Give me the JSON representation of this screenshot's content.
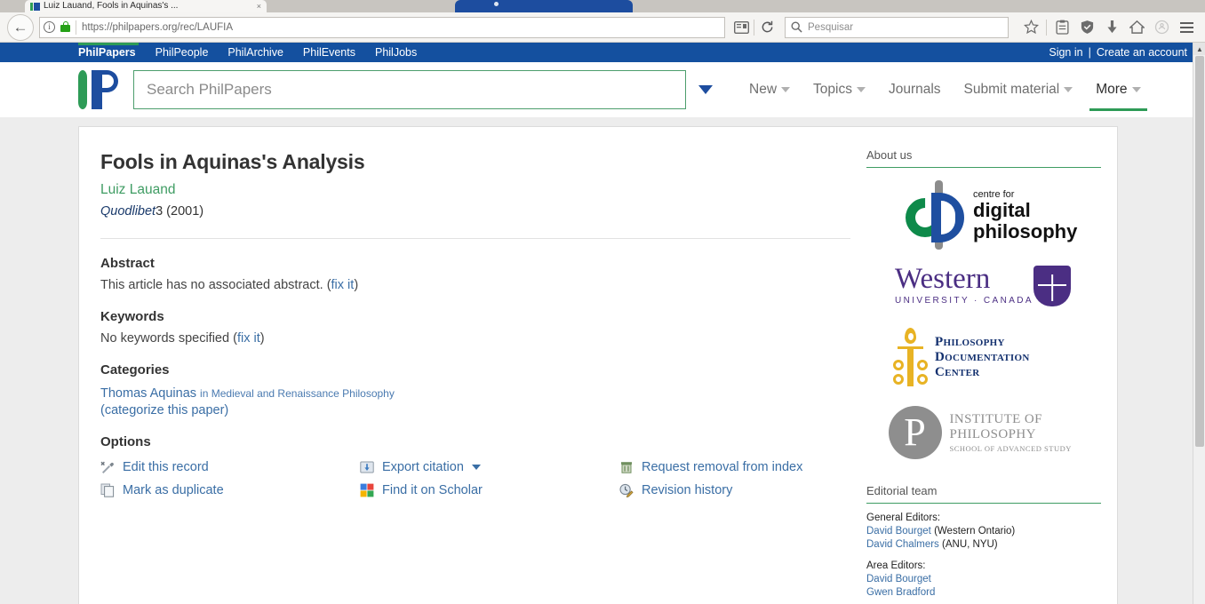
{
  "browser": {
    "tab": {
      "title": "Luiz Lauand, Fools in Aquinas's ...",
      "close_label": "×",
      "favicon": "philpapers-favicon"
    },
    "back_label": "←",
    "url": {
      "scheme": "https://",
      "domain": "philpapers.org",
      "path": "/rec/LAUFIA",
      "full": "https://philpapers.org/rec/LAUFIA"
    },
    "search": {
      "placeholder": "Pesquisar",
      "value": ""
    },
    "icons": [
      "reader-mode-icon",
      "reload-icon",
      "bookmark-star-icon",
      "reading-list-icon",
      "shield-icon",
      "downloads-icon",
      "home-icon",
      "sync-icon",
      "menu-icon"
    ]
  },
  "topnav": {
    "items": [
      {
        "label": "PhilPapers",
        "active": true
      },
      {
        "label": "PhilPeople",
        "active": false
      },
      {
        "label": "PhilArchive",
        "active": false
      },
      {
        "label": "PhilEvents",
        "active": false
      },
      {
        "label": "PhilJobs",
        "active": false
      }
    ],
    "sign_in": "Sign in",
    "separator": "|",
    "create_account": "Create an account"
  },
  "header": {
    "logo_alt": "PhilPapers logo",
    "search_placeholder": "Search PhilPapers",
    "search_value": "",
    "nav": [
      {
        "label": "New",
        "caret": true,
        "current": false
      },
      {
        "label": "Topics",
        "caret": true,
        "current": false
      },
      {
        "label": "Journals",
        "caret": false,
        "current": false
      },
      {
        "label": "Submit material",
        "caret": true,
        "current": false
      },
      {
        "label": "More",
        "caret": true,
        "current": true
      }
    ]
  },
  "article": {
    "title": "Fools in Aquinas's Analysis",
    "author": "Luiz Lauand",
    "journal": "Quodlibet",
    "volume_year": "3 (2001)",
    "abstract": {
      "heading": "Abstract",
      "text": "This article has no associated abstract.",
      "fix_open": "(",
      "fix_label": "fix it",
      "fix_close": ")"
    },
    "keywords": {
      "heading": "Keywords",
      "text": "No keywords specified",
      "fix_open": "(",
      "fix_label": "fix it",
      "fix_close": ")"
    },
    "categories": {
      "heading": "Categories",
      "primary": "Thomas Aquinas",
      "in_text": "in Medieval and Renaissance Philosophy",
      "categorize_link": "(categorize this paper)"
    },
    "options": {
      "heading": "Options",
      "items": [
        {
          "label": "Edit this record",
          "icon": "edit-icon",
          "caret": false
        },
        {
          "label": "Export citation",
          "icon": "export-icon",
          "caret": true
        },
        {
          "label": "Request removal from index",
          "icon": "trash-icon",
          "caret": false
        },
        {
          "label": "Mark as duplicate",
          "icon": "duplicate-icon",
          "caret": false
        },
        {
          "label": "Find it on Scholar",
          "icon": "google-scholar-icon",
          "caret": false
        },
        {
          "label": "Revision history",
          "icon": "history-icon",
          "caret": false
        }
      ]
    }
  },
  "sidebar": {
    "about_heading": "About us",
    "sponsors": [
      {
        "name": "centre for digital philosophy",
        "line1": "centre for",
        "line2": "digital",
        "line3": "philosophy"
      },
      {
        "name": "Western University Canada",
        "line1": "Western",
        "line2": "UNIVERSITY · CANADA"
      },
      {
        "name": "Philosophy Documentation Center",
        "line1": "Philosophy",
        "line2": "Documentation",
        "line3": "Center"
      },
      {
        "name": "Institute of Philosophy",
        "line1": "INSTITUTE OF",
        "line2": "PHILOSOPHY",
        "line3": "SCHOOL OF ADVANCED STUDY",
        "mark": "P"
      }
    ],
    "editorial": {
      "heading": "Editorial team",
      "groups": [
        {
          "label": "General Editors:",
          "people": [
            {
              "name": "David Bourget",
              "affiliation": " (Western Ontario)"
            },
            {
              "name": "David Chalmers",
              "affiliation": " (ANU, NYU)"
            }
          ]
        },
        {
          "label": "Area Editors:",
          "people": [
            {
              "name": "David Bourget",
              "affiliation": ""
            },
            {
              "name": "Gwen Bradford",
              "affiliation": ""
            }
          ]
        }
      ]
    }
  },
  "colors": {
    "brand_blue": "#14509f",
    "brand_green": "#2e9b57",
    "link_blue": "#3a6ea5",
    "author_green": "#3f9c63",
    "page_bg": "#ededed"
  }
}
